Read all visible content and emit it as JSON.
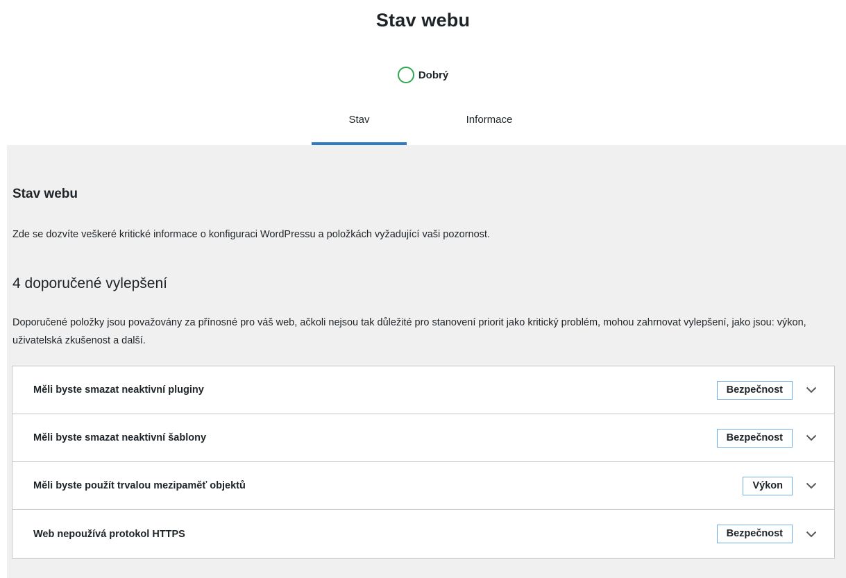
{
  "header": {
    "title": "Stav webu",
    "status_label": "Dobrý",
    "tabs": [
      {
        "label": "Stav"
      },
      {
        "label": "Informace"
      }
    ]
  },
  "section": {
    "title": "Stav webu",
    "description": "Zde se dozvíte veškeré kritické informace o konfiguraci WordPressu a položkách vyžadující vaši pozornost."
  },
  "recommended": {
    "title": "4 doporučené vylepšení",
    "description": "Doporučené položky jsou považovány za přínosné pro váš web, ačkoli nejsou tak důležité pro stanovení priorit jako kritický problém, mohou zahrnovat vylepšení, jako jsou: výkon, uživatelská zkušenost a další.",
    "items": [
      {
        "title": "Měli byste smazat neaktivní pluginy",
        "badge": "Bezpečnost"
      },
      {
        "title": "Měli byste smazat neaktivní šablony",
        "badge": "Bezpečnost"
      },
      {
        "title": "Měli byste použít trvalou mezipaměť objektů",
        "badge": "Výkon"
      },
      {
        "title": "Web nepoužívá protokol HTTPS",
        "badge": "Bezpečnost"
      }
    ]
  },
  "colors": {
    "status_ring": "#2fa84f",
    "active_tab": "#2f7bc2",
    "badge_border": "#72aee6",
    "panel_bg": "#f0f0f1"
  },
  "icons": {
    "status": "circle-ring-icon",
    "expand": "chevron-down-icon"
  }
}
